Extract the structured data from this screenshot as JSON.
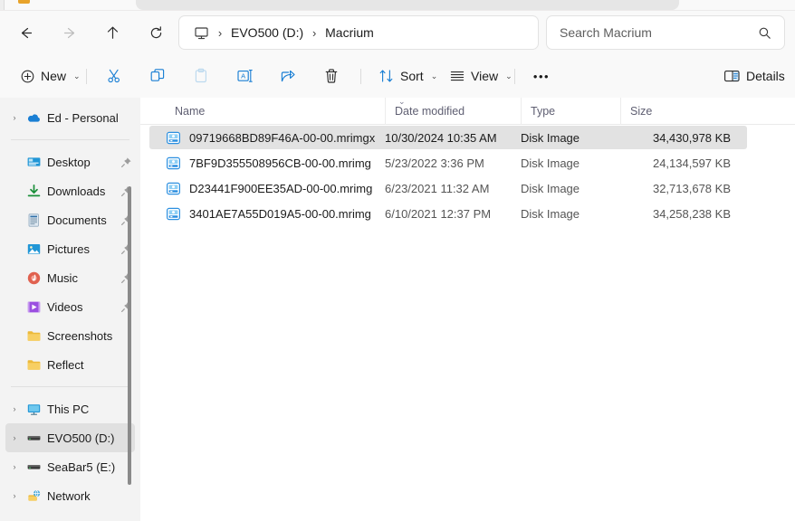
{
  "window": {
    "title": "Macrium",
    "tab_icon": "folder-icon"
  },
  "navigation": {
    "back": "Back",
    "forward": "Forward",
    "up": "Up",
    "refresh": "Refresh",
    "breadcrumb": {
      "root_icon": "this-pc-monitor-icon",
      "separator": "›",
      "items": [
        {
          "label": "EVO500 (D:)"
        },
        {
          "label": "Macrium"
        }
      ]
    }
  },
  "search": {
    "placeholder": "Search Macrium",
    "icon": "search-icon"
  },
  "toolbar": {
    "new_label": "New",
    "new_chevron": "⌄",
    "cut_label": "Cut",
    "copy_label": "Copy",
    "paste_label": "Paste",
    "rename_label": "Rename",
    "share_label": "Share",
    "delete_label": "Delete",
    "sort_label": "Sort",
    "sort_chevron": "⌄",
    "view_label": "View",
    "view_chevron": "⌄",
    "overflow_label": "•••",
    "details_label": "Details"
  },
  "sidebar": {
    "items": [
      {
        "label": "Ed - Personal",
        "icon": "onedrive-cloud-icon",
        "chevron": "›",
        "pinned": false,
        "selected": false
      },
      {
        "type": "divider"
      },
      {
        "label": "Desktop",
        "icon": "desktop-icon",
        "chevron": "",
        "pinned": true,
        "selected": false
      },
      {
        "label": "Downloads",
        "icon": "downloads-icon",
        "chevron": "",
        "pinned": true,
        "selected": false
      },
      {
        "label": "Documents",
        "icon": "documents-icon",
        "chevron": "",
        "pinned": true,
        "selected": false
      },
      {
        "label": "Pictures",
        "icon": "pictures-icon",
        "chevron": "",
        "pinned": true,
        "selected": false
      },
      {
        "label": "Music",
        "icon": "music-icon",
        "chevron": "",
        "pinned": true,
        "selected": false
      },
      {
        "label": "Videos",
        "icon": "videos-icon",
        "chevron": "",
        "pinned": true,
        "selected": false
      },
      {
        "label": "Screenshots",
        "icon": "folder-icon",
        "chevron": "",
        "pinned": false,
        "selected": false
      },
      {
        "label": "Reflect",
        "icon": "folder-icon",
        "chevron": "",
        "pinned": false,
        "selected": false
      },
      {
        "type": "divider"
      },
      {
        "label": "This PC",
        "icon": "this-pc-monitor-icon",
        "chevron": "›",
        "pinned": false,
        "selected": false
      },
      {
        "label": "EVO500 (D:)",
        "icon": "drive-icon",
        "chevron": "›",
        "pinned": false,
        "selected": true
      },
      {
        "label": "SeaBar5 (E:)",
        "icon": "drive-icon",
        "chevron": "›",
        "pinned": false,
        "selected": false
      },
      {
        "label": "Network",
        "icon": "network-icon",
        "chevron": "›",
        "pinned": false,
        "selected": false
      }
    ]
  },
  "file_list": {
    "columns": [
      {
        "key": "name",
        "label": "Name",
        "sorted": false
      },
      {
        "key": "date",
        "label": "Date modified",
        "sorted": true,
        "sort_direction": "descending",
        "sort_glyph": "⌄"
      },
      {
        "key": "type",
        "label": "Type",
        "sorted": false
      },
      {
        "key": "size",
        "label": "Size",
        "sorted": false
      }
    ],
    "rows": [
      {
        "name": "09719668BD89F46A-00-00.mrimgx",
        "date": "10/30/2024 10:35 AM",
        "type": "Disk Image",
        "size": "34,430,978 KB",
        "icon": "disk-image-icon",
        "selected": true
      },
      {
        "name": "7BF9D355508956CB-00-00.mrimg",
        "date": "5/23/2022 3:36 PM",
        "type": "Disk Image",
        "size": "24,134,597 KB",
        "icon": "disk-image-icon",
        "selected": false
      },
      {
        "name": "D23441F900EE35AD-00-00.mrimg",
        "date": "6/23/2021 11:32 AM",
        "type": "Disk Image",
        "size": "32,713,678 KB",
        "icon": "disk-image-icon",
        "selected": false
      },
      {
        "name": "3401AE7A55D019A5-00-00.mrimg",
        "date": "6/10/2021 12:37 PM",
        "type": "Disk Image",
        "size": "34,258,238 KB",
        "icon": "disk-image-icon",
        "selected": false
      }
    ]
  },
  "colors": {
    "accent_blue": "#0078d4",
    "icon_blue": "#1a7fd4",
    "window_bg": "#f9f9f9",
    "sidebar_bg": "#f3f3f3",
    "content_bg": "#ffffff",
    "selection_bg": "#e2e2e2",
    "header_text": "#5f5f72",
    "folder_yellow": "#ecb93a"
  }
}
